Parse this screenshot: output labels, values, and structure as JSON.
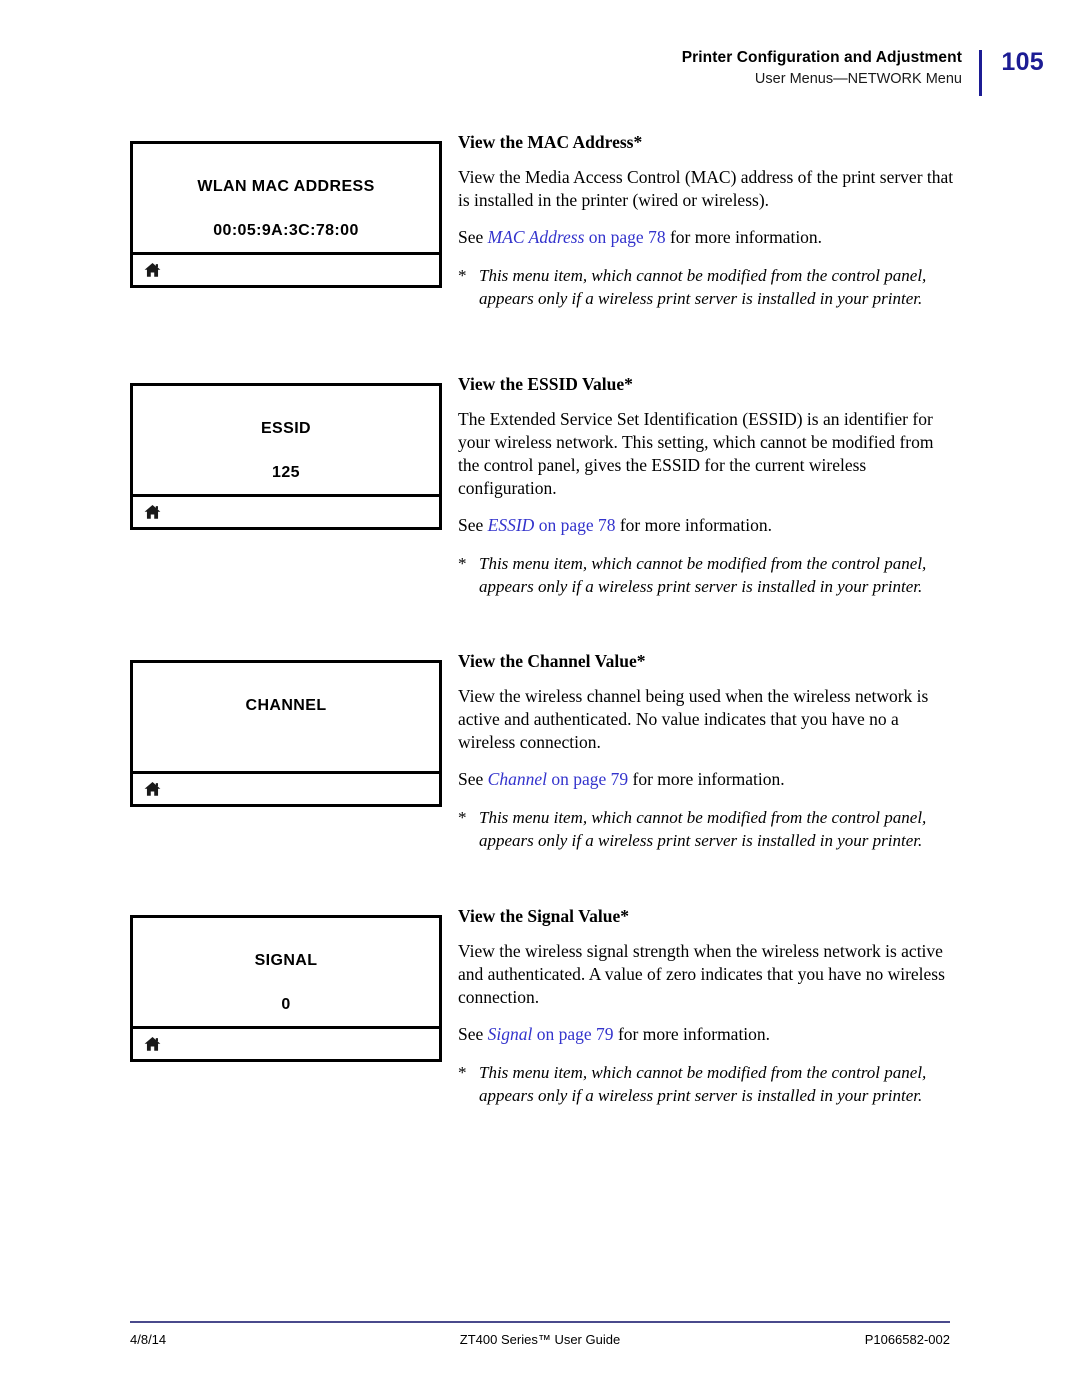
{
  "header": {
    "title": "Printer Configuration and Adjustment",
    "subtitle": "User Menus—NETWORK Menu",
    "page_number": "105",
    "divider_color": "#1c1c94",
    "page_number_color": "#1c1c94"
  },
  "link_color": "#3333cc",
  "sections": [
    {
      "lcd": {
        "title": "WLAN MAC ADDRESS",
        "value": "00:05:9A:3C:78:00",
        "status_icon": "home-icon"
      },
      "heading": "View the MAC Address*",
      "body": "View the Media Access Control (MAC) address of the print server that is installed in the printer (wired or wireless).",
      "xref": {
        "prefix": "See ",
        "title": "MAC Address",
        "page": " on page 78",
        "suffix": " for more information."
      },
      "footnote_star": "*",
      "footnote": "This menu item, which cannot be modified from the control panel, appears only if a wireless print server is installed in your printer."
    },
    {
      "lcd": {
        "title": "ESSID",
        "value": "125",
        "status_icon": "home-icon"
      },
      "heading": "View the ESSID Value*",
      "body": "The Extended Service Set Identification (ESSID) is an identifier for your wireless network. This setting, which cannot be modified from the control panel, gives the ESSID for the current wireless configuration.",
      "xref": {
        "prefix": "See ",
        "title": "ESSID",
        "page": " on page 78",
        "suffix": " for more information."
      },
      "footnote_star": "*",
      "footnote": "This menu item, which cannot be modified from the control panel, appears only if a wireless print server is installed in your printer."
    },
    {
      "lcd": {
        "title": "CHANNEL",
        "value": "",
        "status_icon": "home-icon"
      },
      "heading": "View the Channel Value*",
      "body": "View the wireless channel being used when the wireless network is active and authenticated. No value indicates that you have no a wireless connection.",
      "xref": {
        "prefix": "See ",
        "title": "Channel",
        "page": " on page 79",
        "suffix": " for more information."
      },
      "footnote_star": "*",
      "footnote": "This menu item, which cannot be modified from the control panel, appears only if a wireless print server is installed in your printer."
    },
    {
      "lcd": {
        "title": "SIGNAL",
        "value": "0",
        "status_icon": "home-icon"
      },
      "heading": "View the Signal Value*",
      "body": "View the wireless signal strength when the wireless network is active and authenticated. A value of zero indicates that you have no wireless connection.",
      "xref": {
        "prefix": "See ",
        "title": "Signal",
        "page": " on page 79",
        "suffix": " for more information."
      },
      "footnote_star": "*",
      "footnote": "This menu item, which cannot be modified from the control panel, appears only if a wireless print server is installed in your printer."
    }
  ],
  "footer": {
    "date": "4/8/14",
    "doc_title": "ZT400 Series™ User Guide",
    "part_number": "P1066582-002",
    "rule_color": "#4a4a8c"
  }
}
